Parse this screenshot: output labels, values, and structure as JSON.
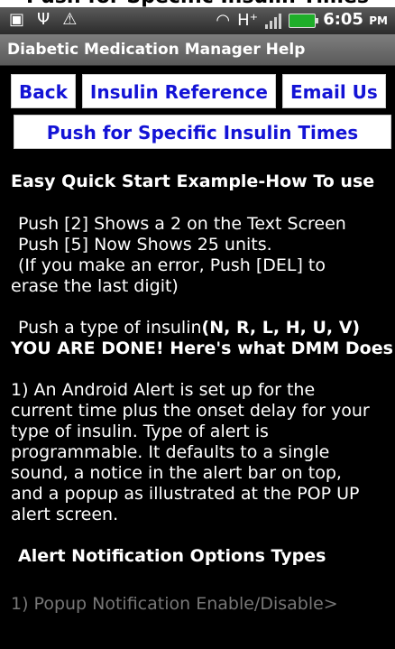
{
  "top_caption": "Push for Specific Insulin Times",
  "status_bar": {
    "icons": [
      "sd-card-icon",
      "usb-icon",
      "warning-icon",
      "wifi-icon",
      "hspa-icon",
      "signal-icon",
      "battery-icon"
    ],
    "hspa_label": "H⁺",
    "time": "6:05",
    "ampm": "PM"
  },
  "title": "Diabetic Medication Manager Help",
  "buttons": {
    "back": "Back",
    "insulin_reference": "Insulin Reference",
    "email_us": "Email Us",
    "specific_times": "Push for Specific Insulin Times"
  },
  "content": {
    "section1_heading": "Easy Quick Start Example-How To use",
    "line_push2": "Push [2]   Shows a 2 on the Text Screen",
    "line_push5": "Push [5]   Now Shows 25 units.",
    "line_error1": "(If you make an error, Push [DEL] to",
    "line_error2": "erase the last digit)",
    "line_type_prefix": "Push a type of insulin",
    "line_type_bold": "(N, R, L, H, U, V)",
    "line_done": "YOU ARE DONE! Here's what DMM Does",
    "para1": [
      " 1) An Android Alert is set up for the",
      "current time plus the onset delay for your",
      "type of insulin. Type of alert is",
      "programmable. It defaults to a single",
      "sound, a notice in the alert bar on top,",
      "and a popup as illustrated at the POP UP",
      "alert screen."
    ],
    "section2_heading": "Alert Notification Options Types",
    "faded_line": " 1) Popup Notification Enable/Disable>"
  },
  "colors": {
    "background": "#000000",
    "button_text": "#1313d6",
    "button_bg": "#ffffff",
    "titlebar": "#6e6e6e"
  }
}
